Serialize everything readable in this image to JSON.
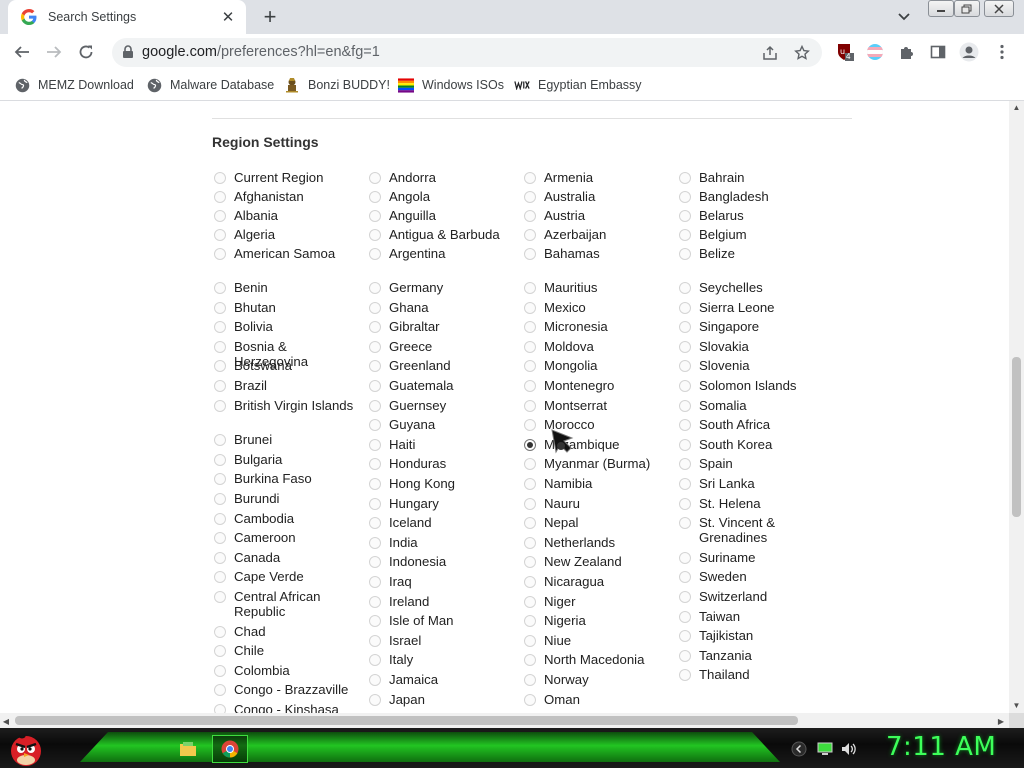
{
  "browser": {
    "tab_title": "Search Settings",
    "url_host": "google.com",
    "url_path": "/preferences?hl=en&fg=1",
    "extension_badge": "4"
  },
  "bookmarks": [
    {
      "label": "MEMZ Download",
      "icon": "globe-icon"
    },
    {
      "label": "Malware Database",
      "icon": "globe-icon"
    },
    {
      "label": "Bonzi BUDDY!",
      "icon": "bonzi-icon"
    },
    {
      "label": "Windows ISOs",
      "icon": "windows-flag-icon"
    },
    {
      "label": "Egyptian Embassy",
      "icon": "wix-icon"
    }
  ],
  "region": {
    "title": "Region Settings",
    "selected": "Mozambique",
    "group1": [
      [
        "Current Region",
        "Afghanistan",
        "Albania",
        "Algeria",
        "American Samoa"
      ],
      [
        "Andorra",
        "Angola",
        "Anguilla",
        "Antigua & Barbuda",
        "Argentina"
      ],
      [
        "Armenia",
        "Australia",
        "Austria",
        "Azerbaijan",
        "Bahamas"
      ],
      [
        "Bahrain",
        "Bangladesh",
        "Belarus",
        "Belgium",
        "Belize"
      ]
    ],
    "group2": [
      [
        "Benin",
        "Bhutan",
        "Bolivia",
        "Bosnia & Herzegovina",
        "Botswana",
        "Brazil",
        "British Virgin Islands",
        "Brunei",
        "Bulgaria",
        "Burkina Faso",
        "Burundi",
        "Cambodia",
        "Cameroon",
        "Canada",
        "Cape Verde",
        "Central African Republic",
        "Chad",
        "Chile",
        "Colombia",
        "Congo - Brazzaville",
        "Congo - Kinshasa"
      ],
      [
        "Germany",
        "Ghana",
        "Gibraltar",
        "Greece",
        "Greenland",
        "Guatemala",
        "Guernsey",
        "Guyana",
        "Haiti",
        "Honduras",
        "Hong Kong",
        "Hungary",
        "Iceland",
        "India",
        "Indonesia",
        "Iraq",
        "Ireland",
        "Isle of Man",
        "Israel",
        "Italy",
        "Jamaica",
        "Japan"
      ],
      [
        "Mauritius",
        "Mexico",
        "Micronesia",
        "Moldova",
        "Mongolia",
        "Montenegro",
        "Montserrat",
        "Morocco",
        "Mozambique",
        "Myanmar (Burma)",
        "Namibia",
        "Nauru",
        "Nepal",
        "Netherlands",
        "New Zealand",
        "Nicaragua",
        "Niger",
        "Nigeria",
        "Niue",
        "North Macedonia",
        "Norway",
        "Oman"
      ],
      [
        "Seychelles",
        "Sierra Leone",
        "Singapore",
        "Slovakia",
        "Slovenia",
        "Solomon Islands",
        "Somalia",
        "South Africa",
        "South Korea",
        "Spain",
        "Sri Lanka",
        "St. Helena",
        "St. Vincent & Grenadines",
        "Suriname",
        "Sweden",
        "Switzerland",
        "Taiwan",
        "Tajikistan",
        "Tanzania",
        "Thailand"
      ]
    ]
  },
  "taskbar": {
    "clock": "7:11 AM"
  }
}
